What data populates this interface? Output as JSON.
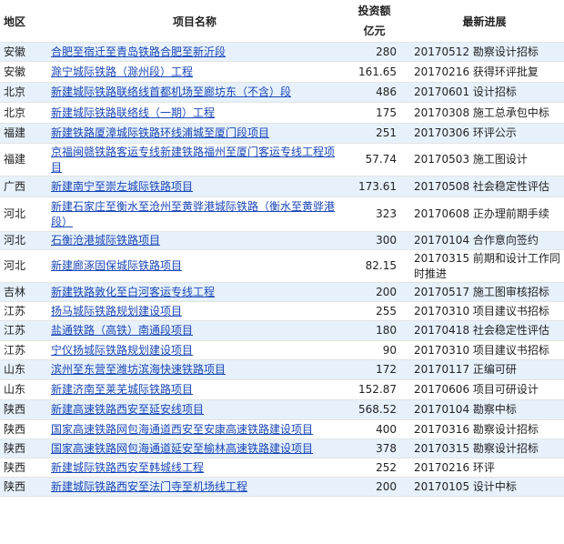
{
  "headers": {
    "region": "地区",
    "project": "项目名称",
    "investment_line1": "投资额",
    "investment_line2": "亿元",
    "progress": "最新进展"
  },
  "rows": [
    {
      "region": "安徽",
      "project": "合肥至宿迁至青岛铁路合肥至新沂段",
      "amount": "280",
      "progress": "20170512 勘察设计招标"
    },
    {
      "region": "安徽",
      "project": "滁宁城际铁路（滁州段）工程",
      "amount": "161.65",
      "progress": "20170216 获得环评批复"
    },
    {
      "region": "北京",
      "project": "新建城际铁路联络线首都机场至廊坊东（不含）段",
      "amount": "486",
      "progress": "20170601 设计招标"
    },
    {
      "region": "北京",
      "project": "新建城际铁路联络线（一期）工程",
      "amount": "175",
      "progress": "20170308 施工总承包中标"
    },
    {
      "region": "福建",
      "project": "新建铁路厦漳城际铁路环线浦城至厦门段项目",
      "amount": "251",
      "progress": "20170306 环评公示"
    },
    {
      "region": "福建",
      "project": "京福闽赣铁路客运专线新建铁路福州至厦门客运专线工程项目",
      "amount": "57.74",
      "progress": "20170503 施工图设计"
    },
    {
      "region": "广西",
      "project": "新建南宁至崇左城际铁路项目",
      "amount": "173.61",
      "progress": "20170508 社会稳定性评估"
    },
    {
      "region": "河北",
      "project": "新建石家庄至衡水至沧州至黄骅港城际铁路（衡水至黄骅港段）",
      "amount": "323",
      "progress": "20170608 正办理前期手续"
    },
    {
      "region": "河北",
      "project": "石衡沧港城际铁路项目",
      "amount": "300",
      "progress": "20170104 合作意向签约"
    },
    {
      "region": "河北",
      "project": "新建廊涿固保城际铁路项目",
      "amount": "82.15",
      "progress": "20170315  前期和设计工作同时推进"
    },
    {
      "region": "吉林",
      "project": "新建铁路敦化至白河客运专线工程",
      "amount": "200",
      "progress": "20170517 施工图审核招标"
    },
    {
      "region": "江苏",
      "project": "扬马城际铁路规划建设项目",
      "amount": "255",
      "progress": "20170310 项目建议书招标"
    },
    {
      "region": "江苏",
      "project": "盐通铁路（高铁）南通段项目",
      "amount": "180",
      "progress": "20170418 社会稳定性评估"
    },
    {
      "region": "江苏",
      "project": "宁仪扬城际铁路规划建设项目",
      "amount": "90",
      "progress": "20170310 项目建议书招标"
    },
    {
      "region": "山东",
      "project": "滨州至东营至潍坊滨海快速铁路项目",
      "amount": "172",
      "progress": "20170117 正编可研"
    },
    {
      "region": "山东",
      "project": "新建济南至莱芜城际铁路项目",
      "amount": "152.87",
      "progress": "20170606 项目可研设计"
    },
    {
      "region": "陕西",
      "project": "新建高速铁路西安至延安线项目",
      "amount": "568.52",
      "progress": "20170104 勘察中标"
    },
    {
      "region": "陕西",
      "project": "国家高速铁路网包海通道西安至安康高速铁路建设项目",
      "amount": "400",
      "progress": "20170316 勘察设计招标"
    },
    {
      "region": "陕西",
      "project": "国家高速铁路网包海通道延安至榆林高速铁路建设项目",
      "amount": "378",
      "progress": "20170315 勘察设计招标"
    },
    {
      "region": "陕西",
      "project": "新建城际铁路西安至韩城线工程",
      "amount": "252",
      "progress": "20170216 环评"
    },
    {
      "region": "陕西",
      "project": "新建城际铁路西安至法门寺至机场线工程",
      "amount": "200",
      "progress": "20170105 设计中标"
    }
  ]
}
